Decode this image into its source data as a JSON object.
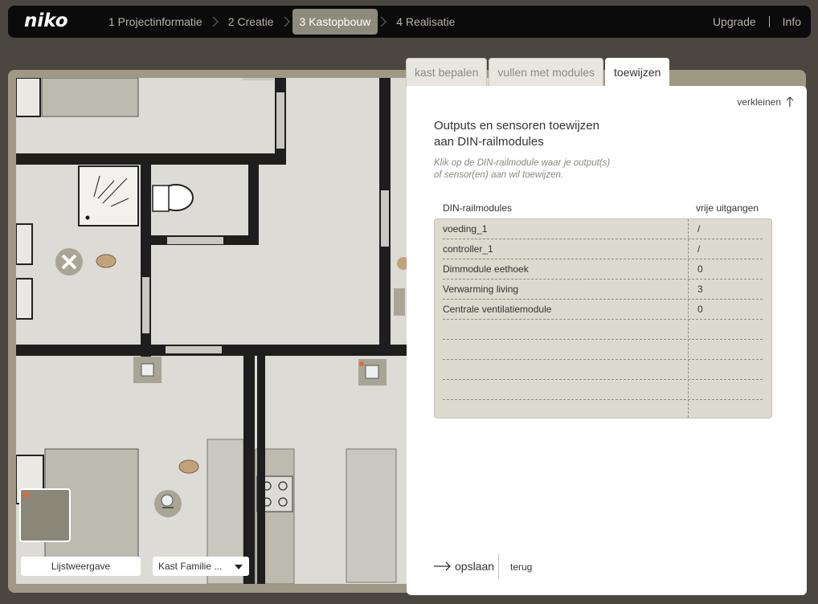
{
  "app": {
    "logo": "niko"
  },
  "steps": [
    {
      "label": "1 Projectinformatie",
      "active": false
    },
    {
      "label": "2 Creatie",
      "active": false
    },
    {
      "label": "3 Kastopbouw",
      "active": true
    },
    {
      "label": "4 Realisatie",
      "active": false
    }
  ],
  "topnav": {
    "upgrade": "Upgrade",
    "info": "Info"
  },
  "tabs": [
    "kast bepalen",
    "vullen met modules",
    "toewijzen"
  ],
  "panel": {
    "shrink_label": "verkleinen",
    "title_line1": "Outputs en sensoren toewijzen",
    "title_line2": "aan DIN-railmodules",
    "instruction_line1": "Klik op de DIN-railmodule waar je output(s)",
    "instruction_line2": "of sensor(en) aan wil toewijzen.",
    "table": {
      "col1": "DIN-railmodules",
      "col2": "vrije uitgangen",
      "rows": [
        {
          "module": "voeding_1",
          "free": "/"
        },
        {
          "module": "controller_1",
          "free": "/"
        },
        {
          "module": "Dimmodule eethoek",
          "free": "0"
        },
        {
          "module": "Verwarming living",
          "free": "3"
        },
        {
          "module": "Centrale ventilatiemodule",
          "free": "0"
        },
        {
          "module": "",
          "free": ""
        },
        {
          "module": "",
          "free": ""
        },
        {
          "module": "",
          "free": ""
        },
        {
          "module": "",
          "free": ""
        }
      ]
    },
    "save_label": "opslaan",
    "back_label": "terug"
  },
  "floorplan": {
    "list_view_button": "Lijstweergave",
    "cabinet_select_value": "Kast Familie ..."
  },
  "colors": {
    "topbar": "#0b0b0b",
    "active_step": "#8e8a7c",
    "background": "#4b463f",
    "table_bg": "#dddad0"
  }
}
